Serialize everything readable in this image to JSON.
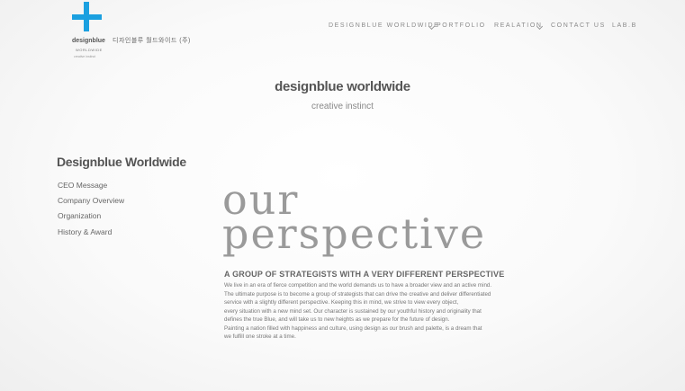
{
  "brand": {
    "name": "designblue",
    "sub": "WORLDWIDE",
    "tag": "creative instinct",
    "company_kr": "디자인블루 월드와이드 (주)",
    "accent": "#1ba0e0"
  },
  "nav": [
    {
      "label": "DESIGNBLUE WORLDWIDE",
      "has_dropdown": true
    },
    {
      "label": "PORTFOLIO",
      "has_dropdown": false
    },
    {
      "label": "REALATION",
      "has_dropdown": true
    },
    {
      "label": "CONTACT US",
      "has_dropdown": false
    },
    {
      "label": "LAB.B",
      "has_dropdown": false
    }
  ],
  "hero": {
    "title": "designblue worldwide",
    "subtitle": "creative instinct"
  },
  "sidebar": {
    "title": "Designblue Worldwide",
    "items": [
      "CEO Message",
      "Company Overview",
      "Organization",
      "History & Award"
    ]
  },
  "content": {
    "big_line1": "our",
    "big_line2": "perspective",
    "headline": "A GROUP OF STRATEGISTS WITH A VERY DIFFERENT PERSPECTIVE",
    "lines": [
      "We live in an era of fierce competition and the world demands us to have a broader view and an active mind.",
      "The ultimate purpose is to become a group of strategists that can drive the creative and deliver differentiated",
      "service with a slightly different perspective. Keeping this in mind, we strive to view every object,",
      "every situation with a new mind set. Our character is sustained by our youthful history and originality that",
      "defines the true Blue, and will take us to new heights as we prepare for the future of design.",
      "Painting a nation filled with happiness and culture, using design as our brush and palette, is a dream that",
      "we fulfill one stroke at a time."
    ]
  }
}
